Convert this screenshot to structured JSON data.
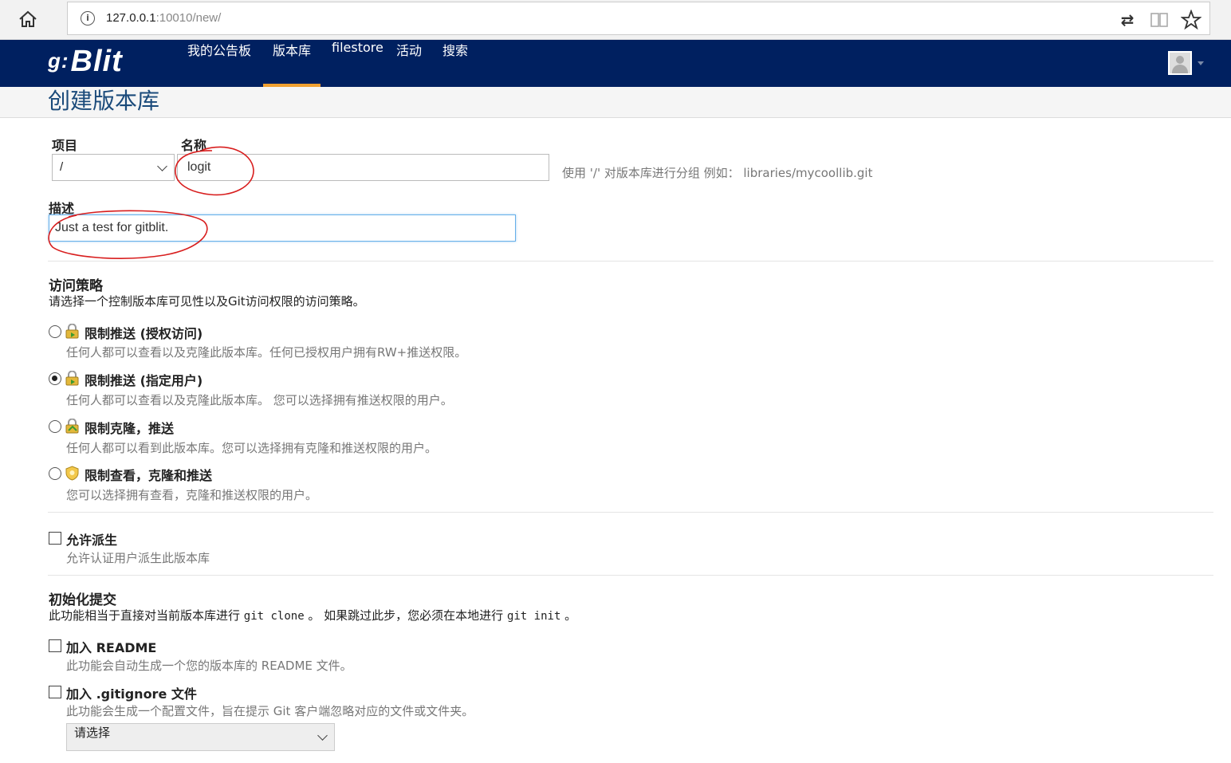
{
  "browser": {
    "url_host": "127.0.0.1",
    "url_path": ":10010/new/",
    "home_icon": "home-icon",
    "info_icon": "i"
  },
  "nav": {
    "logo_text": "Blit",
    "logo_mark": "g:",
    "items": [
      "我的公告板",
      "版本库",
      "filestore",
      "活动",
      "搜索"
    ],
    "active": "版本库",
    "accent": "#f0a030",
    "background": "#002060"
  },
  "page": {
    "title": "创建版本库"
  },
  "form": {
    "project_label": "项目",
    "project_value": "/",
    "name_label": "名称",
    "name_value": "logit",
    "name_help": "使用 '/' 对版本库进行分组 例如： libraries/mycoollib.git",
    "description_label": "描述",
    "description_value": "Just a test for gitblit."
  },
  "access": {
    "title": "访问策略",
    "desc": "请选择一个控制版本库可见性以及Git访问权限的访问策略。",
    "options": [
      {
        "label": "限制推送 (授权访问)",
        "desc": "任何人都可以查看以及克隆此版本库。任何已授权用户拥有RW+推送权限。",
        "checked": false
      },
      {
        "label": "限制推送 (指定用户)",
        "desc": "任何人都可以查看以及克隆此版本库。 您可以选择拥有推送权限的用户。",
        "checked": true
      },
      {
        "label": "限制克隆，推送",
        "desc": "任何人都可以看到此版本库。您可以选择拥有克隆和推送权限的用户。",
        "checked": false
      },
      {
        "label": "限制查看，克隆和推送",
        "desc": "您可以选择拥有查看，克隆和推送权限的用户。",
        "checked": false
      }
    ]
  },
  "fork": {
    "label": "允许派生",
    "desc": "允许认证用户派生此版本库"
  },
  "init": {
    "title": "初始化提交",
    "desc_prefix": "此功能相当于直接对当前版本库进行 ",
    "desc_code1": "git clone",
    "desc_middle": " 。 如果跳过此步，您必须在本地进行 ",
    "desc_code2": "git init",
    "desc_suffix": " 。",
    "readme_label": "加入 README",
    "readme_desc": "此功能会自动生成一个您的版本库的 README 文件。",
    "gitignore_label": "加入 .gitignore 文件",
    "gitignore_desc": "此功能会生成一个配置文件，旨在提示 Git 客户端忽略对应的文件或文件夹。",
    "gitignore_select": "请选择"
  }
}
